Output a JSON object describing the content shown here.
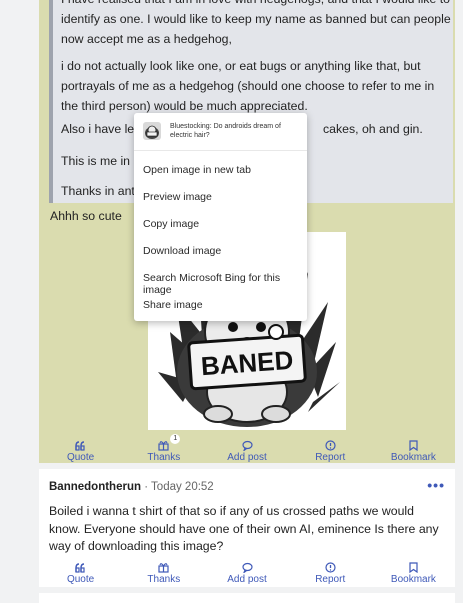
{
  "quote": {
    "line_top": "I have realised that I am in love with hedgehogs, and that I would like to identify as one. I would like to keep my name as banned but can people now accept me as a hedgehog,",
    "para2": "i do not actually look like one, or eat bugs or anything like that, but portrayals of me as a hedgehog (should one choose to refer to me in the third person) would be much appreciated.",
    "para3_start": "Also i have learn",
    "para3_end": "cakes, oh and gin.",
    "para4_start": "This is me in bed",
    "para5_start": "Thanks in anticip"
  },
  "reply_text": "Ahhh so cute",
  "image": {
    "banner_text": "BANED"
  },
  "actions": {
    "quote": "Quote",
    "thanks": "Thanks",
    "thanks_count": "1",
    "add_post": "Add post",
    "report": "Report",
    "bookmark": "Bookmark"
  },
  "post2": {
    "author": "Bannedontherun",
    "separator": "·",
    "timestamp": "Today 20:52",
    "more": "•••",
    "body": "Boiled i wanna t shirt of that so if any of us crossed paths we would know. Everyone should have one of their own AI, eminence Is there any way of downloading this image?"
  },
  "context_menu": {
    "title": "Bluestocking: Do androids dream of electric hair?",
    "items": [
      "Open image in new tab",
      "Preview image",
      "Copy image",
      "Download image",
      "Search Microsoft Bing for this image",
      "Share image"
    ]
  },
  "colors": {
    "accent": "#3f59b8",
    "post_bg": "#dadcaf",
    "quote_bg": "#e3e5ea",
    "page_bg": "#f1f2f3"
  }
}
